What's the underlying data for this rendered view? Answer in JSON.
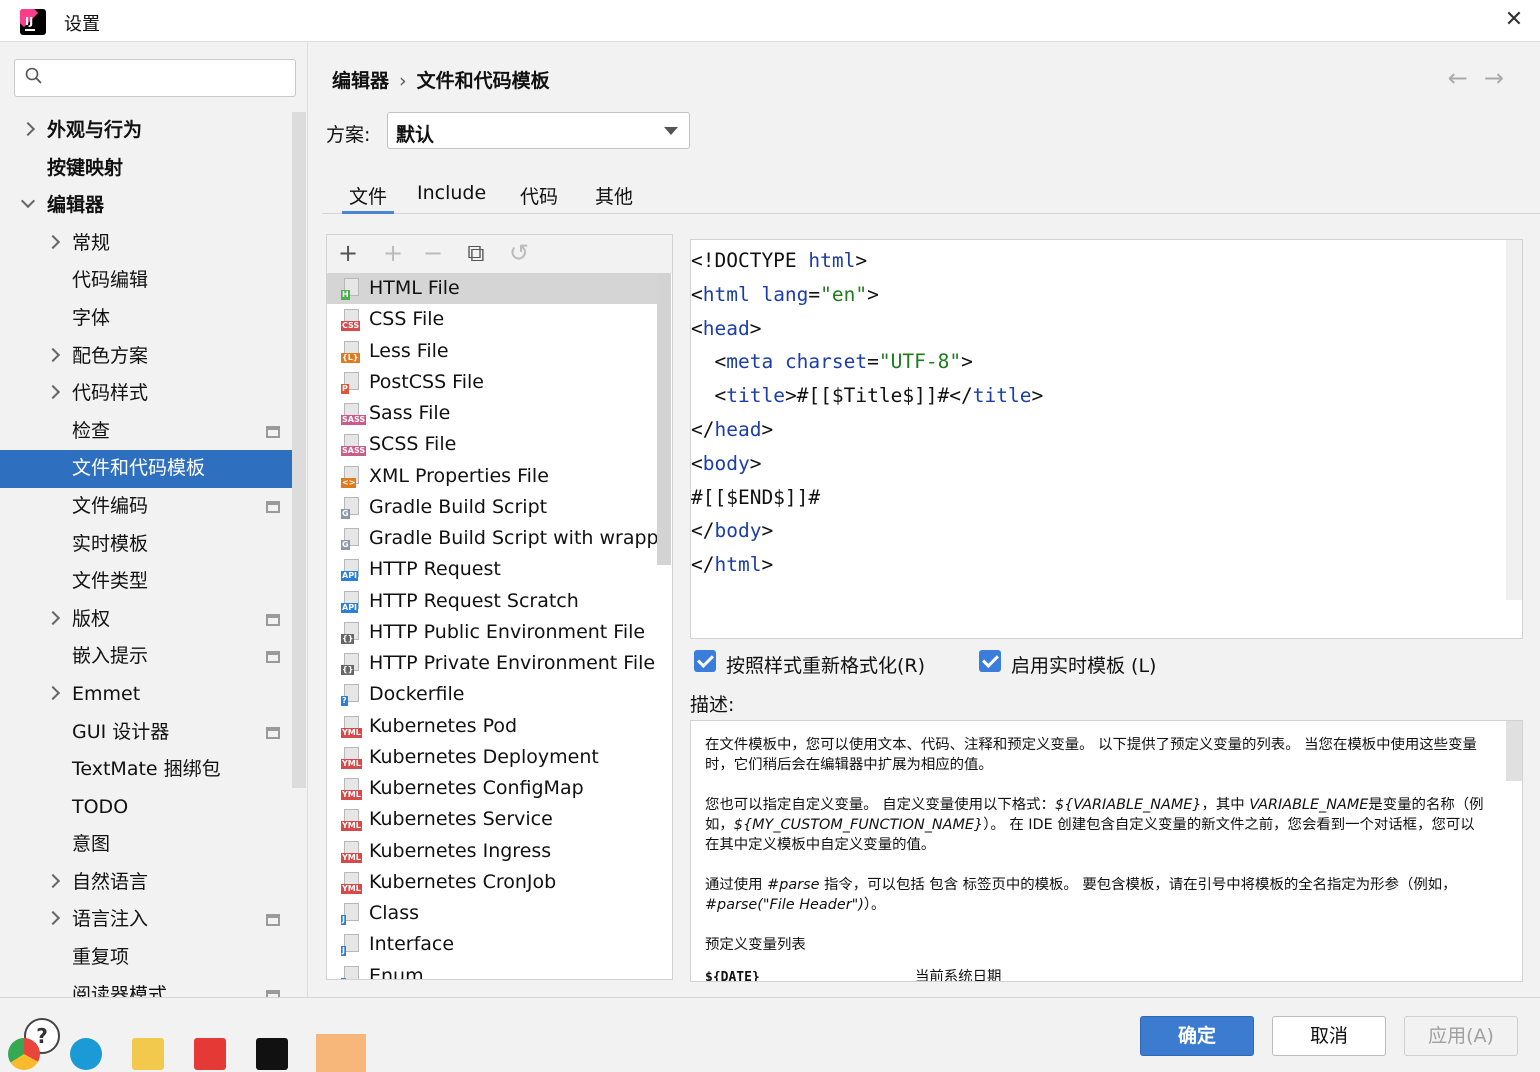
{
  "window": {
    "title": "设置"
  },
  "search": {
    "placeholder": ""
  },
  "sidebar": {
    "items": [
      {
        "label": "外观与行为",
        "level": 0,
        "expand": "right",
        "bold": true
      },
      {
        "label": "按键映射",
        "level": 0,
        "expand": "",
        "bold": true
      },
      {
        "label": "编辑器",
        "level": 0,
        "expand": "down",
        "bold": true
      },
      {
        "label": "常规",
        "level": 1,
        "expand": "right"
      },
      {
        "label": "代码编辑",
        "level": 1,
        "expand": ""
      },
      {
        "label": "字体",
        "level": 1,
        "expand": ""
      },
      {
        "label": "配色方案",
        "level": 1,
        "expand": "right"
      },
      {
        "label": "代码样式",
        "level": 1,
        "expand": "right"
      },
      {
        "label": "检查",
        "level": 1,
        "expand": "",
        "project": true
      },
      {
        "label": "文件和代码模板",
        "level": 1,
        "expand": "",
        "selected": true
      },
      {
        "label": "文件编码",
        "level": 1,
        "expand": "",
        "project": true
      },
      {
        "label": "实时模板",
        "level": 1,
        "expand": ""
      },
      {
        "label": "文件类型",
        "level": 1,
        "expand": ""
      },
      {
        "label": "版权",
        "level": 1,
        "expand": "right",
        "project": true
      },
      {
        "label": "嵌入提示",
        "level": 1,
        "expand": "",
        "project": true
      },
      {
        "label": "Emmet",
        "level": 1,
        "expand": "right"
      },
      {
        "label": "GUI 设计器",
        "level": 1,
        "expand": "",
        "project": true
      },
      {
        "label": "TextMate 捆绑包",
        "level": 1,
        "expand": ""
      },
      {
        "label": "TODO",
        "level": 1,
        "expand": ""
      },
      {
        "label": "意图",
        "level": 1,
        "expand": ""
      },
      {
        "label": "自然语言",
        "level": 1,
        "expand": "right"
      },
      {
        "label": "语言注入",
        "level": 1,
        "expand": "right",
        "project": true
      },
      {
        "label": "重复项",
        "level": 1,
        "expand": ""
      },
      {
        "label": "阅读器模式",
        "level": 1,
        "expand": "",
        "project": true
      }
    ]
  },
  "breadcrumb": {
    "parent": "编辑器",
    "current": "文件和代码模板"
  },
  "scheme": {
    "label": "方案:",
    "value": "默认"
  },
  "tabs": [
    {
      "label": "文件",
      "active": true
    },
    {
      "label": "Include"
    },
    {
      "label": "代码"
    },
    {
      "label": "其他"
    }
  ],
  "templates": [
    {
      "name": "HTML File",
      "tag": "H",
      "tagColor": "#4caf50",
      "selected": true
    },
    {
      "name": "CSS File",
      "tag": "CSS",
      "tagColor": "#d84a4a"
    },
    {
      "name": "Less File",
      "tag": "{L}",
      "tagColor": "#e07a1f"
    },
    {
      "name": "PostCSS File",
      "tag": "P",
      "tagColor": "#e0553a"
    },
    {
      "name": "Sass File",
      "tag": "SASS",
      "tagColor": "#cc5a8a"
    },
    {
      "name": "SCSS File",
      "tag": "SASS",
      "tagColor": "#cc5a8a"
    },
    {
      "name": "XML Properties File",
      "tag": "<>",
      "tagColor": "#e07a1f"
    },
    {
      "name": "Gradle Build Script",
      "tag": "G",
      "tagColor": "#8a98a8"
    },
    {
      "name": "Gradle Build Script with wrapper",
      "tag": "G",
      "tagColor": "#8a98a8"
    },
    {
      "name": "HTTP Request",
      "tag": "API",
      "tagColor": "#2d7fd3"
    },
    {
      "name": "HTTP Request Scratch",
      "tag": "API",
      "tagColor": "#2d7fd3"
    },
    {
      "name": "HTTP Public Environment File",
      "tag": "{}",
      "tagColor": "#666666"
    },
    {
      "name": "HTTP Private Environment File",
      "tag": "{}",
      "tagColor": "#666666"
    },
    {
      "name": "Dockerfile",
      "tag": "?",
      "tagColor": "#2d7fd3"
    },
    {
      "name": "Kubernetes Pod",
      "tag": "YML",
      "tagColor": "#d84a4a"
    },
    {
      "name": "Kubernetes Deployment",
      "tag": "YML",
      "tagColor": "#d84a4a"
    },
    {
      "name": "Kubernetes ConfigMap",
      "tag": "YML",
      "tagColor": "#d84a4a"
    },
    {
      "name": "Kubernetes Service",
      "tag": "YML",
      "tagColor": "#d84a4a"
    },
    {
      "name": "Kubernetes Ingress",
      "tag": "YML",
      "tagColor": "#d84a4a"
    },
    {
      "name": "Kubernetes CronJob",
      "tag": "YML",
      "tagColor": "#d84a4a"
    },
    {
      "name": "Class",
      "tag": "J",
      "tagColor": "#2d7fd3"
    },
    {
      "name": "Interface",
      "tag": "J",
      "tagColor": "#2d7fd3"
    },
    {
      "name": "Enum",
      "tag": "J",
      "tagColor": "#2d7fd3"
    }
  ],
  "toolbar": {
    "add": "+",
    "add_child": "+",
    "remove": "−",
    "copy": "⧉",
    "reset": "↺"
  },
  "code_lines": [
    [
      [
        "t",
        "<!DOCTYPE "
      ],
      [
        "a",
        "html"
      ],
      [
        "t",
        ">"
      ]
    ],
    [
      [
        "t",
        "<"
      ],
      [
        "a",
        "html "
      ],
      [
        "a",
        "lang"
      ],
      [
        "t",
        "="
      ],
      [
        "s",
        "\"en\""
      ],
      [
        "t",
        ">"
      ]
    ],
    [
      [
        "t",
        "<"
      ],
      [
        "a",
        "head"
      ],
      [
        "t",
        ">"
      ]
    ],
    [
      [
        "t",
        "  <"
      ],
      [
        "a",
        "meta "
      ],
      [
        "a",
        "charset"
      ],
      [
        "t",
        "="
      ],
      [
        "s",
        "\"UTF-8\""
      ],
      [
        "t",
        ">"
      ]
    ],
    [
      [
        "t",
        "  <"
      ],
      [
        "a",
        "title"
      ],
      [
        "t",
        ">#[[$Title$]]#</"
      ],
      [
        "a",
        "title"
      ],
      [
        "t",
        ">"
      ]
    ],
    [
      [
        "t",
        "</"
      ],
      [
        "a",
        "head"
      ],
      [
        "t",
        ">"
      ]
    ],
    [
      [
        "t",
        "<"
      ],
      [
        "a",
        "body"
      ],
      [
        "t",
        ">"
      ]
    ],
    [
      [
        "t",
        "#[[$END$]]#"
      ]
    ],
    [
      [
        "t",
        "</"
      ],
      [
        "a",
        "body"
      ],
      [
        "t",
        ">"
      ]
    ],
    [
      [
        "t",
        "</"
      ],
      [
        "a",
        "html"
      ],
      [
        "t",
        ">"
      ]
    ]
  ],
  "options": {
    "reformat": "按照样式重新格式化(R)",
    "live_templates": "启用实时模板 (L)"
  },
  "description": {
    "label": "描述:",
    "p1": "在文件模板中，您可以使用文本、代码、注释和预定义变量。 以下提供了预定义变量的列表。 当您在模板中使用这些变量时，它们稍后会在编辑器中扩展为相应的值。",
    "p2_a": "您也可以指定自定义变量。 自定义变量使用以下格式：",
    "p2_var": "${VARIABLE_NAME}",
    "p2_b": "，其中 ",
    "p2_var2": "VARIABLE_NAME",
    "p2_c": "是变量的名称（例如，",
    "p2_var3": "${MY_CUSTOM_FUNCTION_NAME}",
    "p2_d": "）。 在 IDE 创建包含自定义变量的新文件之前，您会看到一个对话框，您可以在其中定义模板中自定义变量的值。",
    "p3_a": "通过使用 ",
    "p3_parse": "#parse",
    "p3_b": " 指令，可以包括 包含 标签页中的模板。 要包含模板，请在引号中将模板的全名指定为形参（例如，",
    "p3_example": "#parse(\"File Header\")",
    "p3_c": "）。",
    "p4": "预定义变量列表",
    "var_name": "${DATE}",
    "var_desc": "当前系统日期"
  },
  "buttons": {
    "ok": "确定",
    "cancel": "取消",
    "apply": "应用(A)"
  },
  "help": "?"
}
